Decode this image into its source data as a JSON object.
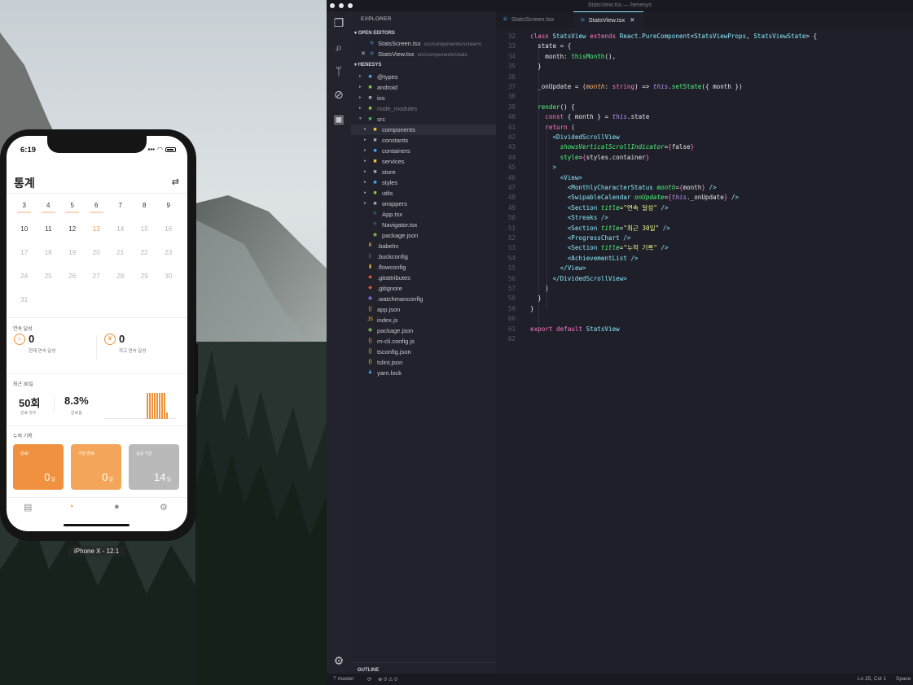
{
  "simulator": {
    "label": "iPhone X - 12.1",
    "status_time": "6:19",
    "title": "통계",
    "calendar": [
      [
        {
          "d": "3",
          "c": "week"
        },
        {
          "d": "4",
          "c": "week"
        },
        {
          "d": "5",
          "c": "week"
        },
        {
          "d": "6",
          "c": "week"
        },
        {
          "d": "7",
          "c": ""
        },
        {
          "d": "8",
          "c": ""
        },
        {
          "d": "9",
          "c": ""
        }
      ],
      [
        {
          "d": "10",
          "c": ""
        },
        {
          "d": "11",
          "c": ""
        },
        {
          "d": "12",
          "c": ""
        },
        {
          "d": "13",
          "c": "today"
        },
        {
          "d": "14",
          "c": "dim"
        },
        {
          "d": "15",
          "c": "dim"
        },
        {
          "d": "16",
          "c": "dim"
        }
      ],
      [
        {
          "d": "17",
          "c": "dim"
        },
        {
          "d": "18",
          "c": "dim"
        },
        {
          "d": "19",
          "c": "dim"
        },
        {
          "d": "20",
          "c": "dim"
        },
        {
          "d": "21",
          "c": "dim"
        },
        {
          "d": "22",
          "c": "dim"
        },
        {
          "d": "23",
          "c": "dim"
        }
      ],
      [
        {
          "d": "24",
          "c": "dim"
        },
        {
          "d": "25",
          "c": "dim"
        },
        {
          "d": "26",
          "c": "dim"
        },
        {
          "d": "27",
          "c": "dim"
        },
        {
          "d": "28",
          "c": "dim"
        },
        {
          "d": "29",
          "c": "dim"
        },
        {
          "d": "30",
          "c": "dim"
        }
      ],
      [
        {
          "d": "31",
          "c": "dim"
        }
      ]
    ],
    "streak_section": "연속 달성",
    "current_streak": {
      "value": "0",
      "label": "현재 연속 달성"
    },
    "best_streak": {
      "value": "0",
      "label": "최고 연속 달성"
    },
    "recent_section": "최근 30일",
    "recent_count": {
      "value": "50회",
      "label": "완료 횟수"
    },
    "recent_rate": {
      "value": "8.3%",
      "label": "완료율"
    },
    "chart_bar_count": 9,
    "history_section": "누적 기록",
    "cards": [
      {
        "title": "완료!",
        "value": "0",
        "unit": "일",
        "color": "#f0913f"
      },
      {
        "title": "가장 환료",
        "value": "0",
        "unit": "일",
        "color": "#f3a65a"
      },
      {
        "title": "성공 기간",
        "value": "14",
        "unit": "일",
        "color": "#b9b9b9"
      }
    ],
    "accent_color": "#f0923a"
  },
  "vscode": {
    "window_title": "StatsView.tsx — henesys",
    "explorer_title": "EXPLORER",
    "open_editors_title": "OPEN EDITORS",
    "open_editors": [
      {
        "name": "StatsScreen.tsx",
        "path": "src/components/screens"
      },
      {
        "name": "StatsView.tsx",
        "path": "src/components/stats"
      }
    ],
    "workspace_title": "HENESYS",
    "tree": [
      {
        "name": "@types",
        "kind": "folder",
        "depth": 1,
        "arrow": "closed",
        "color": "#4aa0e6"
      },
      {
        "name": "android",
        "kind": "folder",
        "depth": 1,
        "arrow": "closed",
        "color": "#8bc34a"
      },
      {
        "name": "ios",
        "kind": "folder",
        "depth": 1,
        "arrow": "closed",
        "color": "#9ea4b0"
      },
      {
        "name": "node_modules",
        "kind": "folder",
        "depth": 1,
        "arrow": "closed",
        "color": "#8bc34a",
        "dim": true
      },
      {
        "name": "src",
        "kind": "folder",
        "depth": 1,
        "arrow": "open",
        "color": "#4caf50"
      },
      {
        "name": "components",
        "kind": "folder",
        "depth": 2,
        "arrow": "closed",
        "color": "#f5c542",
        "selected": true
      },
      {
        "name": "constants",
        "kind": "folder",
        "depth": 2,
        "arrow": "closed",
        "color": "#9ea4b0"
      },
      {
        "name": "containers",
        "kind": "folder",
        "depth": 2,
        "arrow": "closed",
        "color": "#4aa0e6"
      },
      {
        "name": "services",
        "kind": "folder",
        "depth": 2,
        "arrow": "closed",
        "color": "#f5c542"
      },
      {
        "name": "store",
        "kind": "folder",
        "depth": 2,
        "arrow": "closed",
        "color": "#9ea4b0"
      },
      {
        "name": "styles",
        "kind": "folder",
        "depth": 2,
        "arrow": "closed",
        "color": "#4aa0e6"
      },
      {
        "name": "utils",
        "kind": "folder",
        "depth": 2,
        "arrow": "closed",
        "color": "#8bc34a"
      },
      {
        "name": "wrappers",
        "kind": "folder",
        "depth": 2,
        "arrow": "closed",
        "color": "#9ea4b0"
      },
      {
        "name": "App.tsx",
        "kind": "file",
        "depth": 2,
        "icon": "⚛",
        "color": "#4fb3ff"
      },
      {
        "name": "Navigator.tsx",
        "kind": "file",
        "depth": 2,
        "icon": "⚛",
        "color": "#4fb3ff"
      },
      {
        "name": "package.json",
        "kind": "file",
        "depth": 2,
        "icon": "◉",
        "color": "#8bc34a"
      },
      {
        "name": ".babelrc",
        "kind": "file",
        "depth": 1,
        "icon": "B",
        "color": "#f5c542"
      },
      {
        "name": ".buckconfig",
        "kind": "file",
        "depth": 1,
        "icon": "▯",
        "color": "#4aa0e6"
      },
      {
        "name": ".flowconfig",
        "kind": "file",
        "depth": 1,
        "icon": "▮",
        "color": "#e8b03a"
      },
      {
        "name": ".gitattributes",
        "kind": "file",
        "depth": 1,
        "icon": "◆",
        "color": "#e8553a"
      },
      {
        "name": ".gitignore",
        "kind": "file",
        "depth": 1,
        "icon": "◆",
        "color": "#e8553a"
      },
      {
        "name": ".watchmanconfig",
        "kind": "file",
        "depth": 1,
        "icon": "◉",
        "color": "#8a7cf0"
      },
      {
        "name": "app.json",
        "kind": "file",
        "depth": 1,
        "icon": "{}",
        "color": "#f5c542"
      },
      {
        "name": "index.js",
        "kind": "file",
        "depth": 1,
        "icon": "JS",
        "color": "#f5c542"
      },
      {
        "name": "package.json",
        "kind": "file",
        "depth": 1,
        "icon": "◉",
        "color": "#8bc34a"
      },
      {
        "name": "rn-cli.config.js",
        "kind": "file",
        "depth": 1,
        "icon": "{}",
        "color": "#f5c542"
      },
      {
        "name": "tsconfig.json",
        "kind": "file",
        "depth": 1,
        "icon": "{}",
        "color": "#f5c542"
      },
      {
        "name": "tslint.json",
        "kind": "file",
        "depth": 1,
        "icon": "{}",
        "color": "#f5c542"
      },
      {
        "name": "yarn.lock",
        "kind": "file",
        "depth": 1,
        "icon": "♟",
        "color": "#4aa0e6"
      }
    ],
    "outline_title": "OUTLINE",
    "tabs": [
      {
        "label": "StatsScreen.tsx",
        "active": false
      },
      {
        "label": "StatsView.tsx",
        "active": true
      }
    ],
    "code": [
      {
        "n": "32",
        "t": [
          [
            "kw",
            "class "
          ],
          [
            "cls",
            "StatsView "
          ],
          [
            "kw",
            "extends "
          ],
          [
            "cls",
            "React.PureComponent"
          ],
          [
            "p",
            "<"
          ],
          [
            "cls",
            "StatsViewProps"
          ],
          [
            "p",
            ", "
          ],
          [
            "cls",
            "StatsViewState"
          ],
          [
            "p",
            "> {"
          ]
        ]
      },
      {
        "n": "33",
        "t": [
          [
            "p",
            "  "
          ],
          [
            "prop",
            "state"
          ],
          [
            "p",
            " = {"
          ]
        ]
      },
      {
        "n": "34",
        "t": [
          [
            "p",
            "    "
          ],
          [
            "prop",
            "month"
          ],
          [
            "p",
            ": "
          ],
          [
            "fn",
            "thisMonth"
          ],
          [
            "p",
            "(),"
          ]
        ]
      },
      {
        "n": "35",
        "t": [
          [
            "p",
            "  }"
          ]
        ]
      },
      {
        "n": "36",
        "t": []
      },
      {
        "n": "37",
        "t": [
          [
            "p",
            "  "
          ],
          [
            "prop",
            "_onUpdate"
          ],
          [
            "p",
            " = ("
          ],
          [
            "param",
            "month"
          ],
          [
            "p",
            ": "
          ],
          [
            "kw",
            "string"
          ],
          [
            "p",
            ") => "
          ],
          [
            "this",
            "this"
          ],
          [
            "p",
            "."
          ],
          [
            "fn",
            "setState"
          ],
          [
            "p",
            "({ "
          ],
          [
            "prop",
            "month"
          ],
          [
            "p",
            " })"
          ]
        ]
      },
      {
        "n": "38",
        "t": []
      },
      {
        "n": "39",
        "t": [
          [
            "p",
            "  "
          ],
          [
            "fn",
            "render"
          ],
          [
            "p",
            "() {"
          ]
        ]
      },
      {
        "n": "40",
        "t": [
          [
            "p",
            "    "
          ],
          [
            "kw",
            "const"
          ],
          [
            "p",
            " { "
          ],
          [
            "prop",
            "month"
          ],
          [
            "p",
            " } = "
          ],
          [
            "this",
            "this"
          ],
          [
            "p",
            "."
          ],
          [
            "prop",
            "state"
          ]
        ]
      },
      {
        "n": "41",
        "t": [
          [
            "p",
            "    "
          ],
          [
            "kw",
            "return"
          ],
          [
            "p",
            " ("
          ]
        ]
      },
      {
        "n": "42",
        "t": [
          [
            "p",
            "      "
          ],
          [
            "tag",
            "<DividedScrollView"
          ]
        ]
      },
      {
        "n": "43",
        "t": [
          [
            "p",
            "        "
          ],
          [
            "attr",
            "showsVerticalScrollIndicator"
          ],
          [
            "p",
            "="
          ],
          [
            "brace",
            "{"
          ],
          [
            "val",
            "false"
          ],
          [
            "brace",
            "}"
          ]
        ]
      },
      {
        "n": "44",
        "t": [
          [
            "p",
            "        "
          ],
          [
            "attr2",
            "style"
          ],
          [
            "p",
            "="
          ],
          [
            "brace",
            "{"
          ],
          [
            "val",
            "styles.container"
          ],
          [
            "brace",
            "}"
          ]
        ]
      },
      {
        "n": "45",
        "t": [
          [
            "p",
            "      "
          ],
          [
            "tag",
            ">"
          ]
        ]
      },
      {
        "n": "46",
        "t": [
          [
            "p",
            "        "
          ],
          [
            "tag",
            "<View>"
          ]
        ]
      },
      {
        "n": "47",
        "t": [
          [
            "p",
            "          "
          ],
          [
            "tag",
            "<MonthlyCharacterStatus "
          ],
          [
            "attr",
            "month"
          ],
          [
            "p",
            "="
          ],
          [
            "brace",
            "{"
          ],
          [
            "val",
            "month"
          ],
          [
            "brace",
            "}"
          ],
          [
            "tag",
            " />"
          ]
        ]
      },
      {
        "n": "48",
        "t": [
          [
            "p",
            "          "
          ],
          [
            "tag",
            "<SwipableCalendar "
          ],
          [
            "attr",
            "onUpdate"
          ],
          [
            "p",
            "="
          ],
          [
            "brace",
            "{"
          ],
          [
            "this",
            "this"
          ],
          [
            "val",
            "._onUpdate"
          ],
          [
            "brace",
            "}"
          ],
          [
            "tag",
            " />"
          ]
        ]
      },
      {
        "n": "49",
        "t": [
          [
            "p",
            "          "
          ],
          [
            "tag",
            "<Section "
          ],
          [
            "attr",
            "title"
          ],
          [
            "p",
            "="
          ],
          [
            "str",
            "\"연속 달성\""
          ],
          [
            "tag",
            " />"
          ]
        ]
      },
      {
        "n": "50",
        "t": [
          [
            "p",
            "          "
          ],
          [
            "tag",
            "<Streaks />"
          ]
        ]
      },
      {
        "n": "51",
        "t": [
          [
            "p",
            "          "
          ],
          [
            "tag",
            "<Section "
          ],
          [
            "attr",
            "title"
          ],
          [
            "p",
            "="
          ],
          [
            "str",
            "\"최근 30일\""
          ],
          [
            "tag",
            " />"
          ]
        ]
      },
      {
        "n": "52",
        "t": [
          [
            "p",
            "          "
          ],
          [
            "tag",
            "<ProgressChart />"
          ]
        ]
      },
      {
        "n": "53",
        "t": [
          [
            "p",
            "          "
          ],
          [
            "tag",
            "<Section "
          ],
          [
            "attr",
            "title"
          ],
          [
            "p",
            "="
          ],
          [
            "str",
            "\"누적 기록\""
          ],
          [
            "tag",
            " />"
          ]
        ]
      },
      {
        "n": "54",
        "t": [
          [
            "p",
            "          "
          ],
          [
            "tag",
            "<AchievementList />"
          ]
        ]
      },
      {
        "n": "55",
        "t": [
          [
            "p",
            "        "
          ],
          [
            "tag",
            "</View>"
          ]
        ]
      },
      {
        "n": "56",
        "t": [
          [
            "p",
            "      "
          ],
          [
            "tag",
            "</DividedScrollView>"
          ]
        ]
      },
      {
        "n": "57",
        "t": [
          [
            "p",
            "    )"
          ]
        ]
      },
      {
        "n": "58",
        "t": [
          [
            "p",
            "  }"
          ]
        ]
      },
      {
        "n": "59",
        "t": [
          [
            "p",
            "}"
          ]
        ]
      },
      {
        "n": "60",
        "t": []
      },
      {
        "n": "61",
        "t": [
          [
            "kw",
            "export default "
          ],
          [
            "cls",
            "StatsView"
          ]
        ]
      },
      {
        "n": "62",
        "t": []
      }
    ],
    "syntax_colors": {
      "kw": "#ff79c6",
      "cls": "#8be9fd",
      "p": "#e8e8ee",
      "prop": "#e8e8ee",
      "fn": "#50fa7b",
      "param": "#ffb86c",
      "this": "#bd93f9",
      "tag": "#8be9fd",
      "attr": "#50fa7b",
      "attr2": "#50fa7b",
      "brace": "#ff79c6",
      "val": "#e8e8ee",
      "str": "#f1fa8c"
    },
    "status": {
      "branch": "master",
      "problems": "⊗ 0 ⚠ 0",
      "cursor": "Ln 25, Col 1",
      "spaces": "Space"
    }
  }
}
